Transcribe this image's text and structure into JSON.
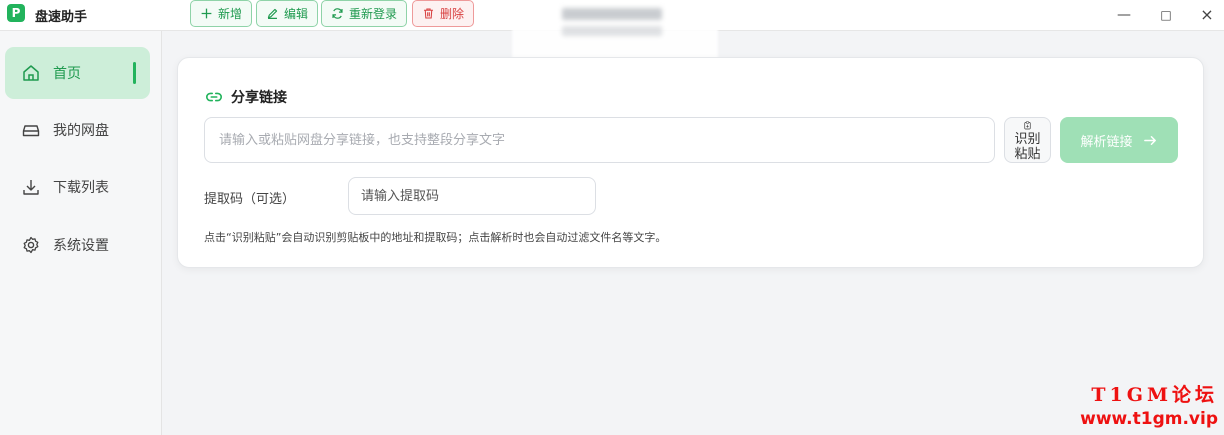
{
  "app": {
    "logo_letter": "P",
    "title": "盘速助手"
  },
  "toolbar": {
    "add_label": "新增",
    "edit_label": "编辑",
    "relogin_label": "重新登录",
    "delete_label": "删除"
  },
  "window_controls": {
    "minimize": "—",
    "maximize": "□",
    "close": "×"
  },
  "sidebar": {
    "items": [
      {
        "label": "首页",
        "icon": "home-icon",
        "active": true
      },
      {
        "label": "我的网盘",
        "icon": "drive-icon",
        "active": false
      },
      {
        "label": "下载列表",
        "icon": "download-icon",
        "active": false
      },
      {
        "label": "系统设置",
        "icon": "gear-icon",
        "active": false
      }
    ]
  },
  "main": {
    "card_title": "分享链接",
    "link_placeholder": "请输入或粘贴网盘分享链接，也支持整段分享文字",
    "paste_button": {
      "line1": "识别",
      "line2": "粘贴"
    },
    "parse_button": "解析链接",
    "code_label": "提取码（可选）",
    "code_placeholder": "请输入提取码",
    "hint": "点击“识别粘贴”会自动识别剪贴板中的地址和提取码；点击解析时也会自动过滤文件名等文字。"
  },
  "watermark": {
    "line1": "T1GM论坛",
    "line2": "www.t1gm.vip"
  },
  "colors": {
    "accent": "#22b35c",
    "accent_light": "#cdeed9",
    "danger": "#d84040",
    "parse_disabled": "#9fe0b6"
  }
}
